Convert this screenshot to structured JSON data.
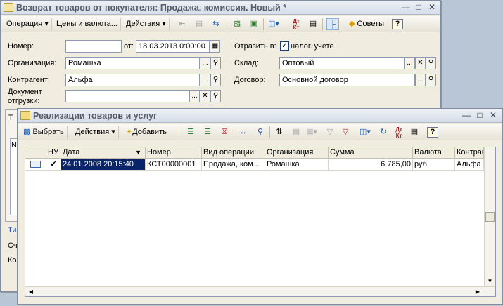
{
  "main_window": {
    "title": "Возврат товаров от покупателя: Продажа, комиссия. Новый *",
    "toolbar": {
      "operation": "Операция",
      "prices": "Цены и валюта...",
      "actions": "Действия",
      "tips": "Советы"
    },
    "form": {
      "number_label": "Номер:",
      "number_value": "",
      "date_label": "от:",
      "date_value": "18.03.2013  0:00:00",
      "reflect_label": "Отразить в:",
      "tax_label": "налог. учете",
      "org_label": "Организация:",
      "org_value": "Ромашка",
      "warehouse_label": "Склад:",
      "warehouse_value": "Оптовый",
      "contractor_label": "Контрагент:",
      "contractor_value": "Альфа",
      "contract_label": "Договор:",
      "contract_value": "Основной договор",
      "doc_label_1": "Документ",
      "doc_label_2": "отгрузки:",
      "doc_value": ""
    },
    "partial": {
      "t": "Т",
      "n": "N",
      "ti": "Ти",
      "sch": "Сч",
      "ko": "Ко"
    }
  },
  "list_window": {
    "title": "Реализации товаров и услуг",
    "toolbar": {
      "select": "Выбрать",
      "actions": "Действия",
      "add": "Добавить"
    },
    "columns": [
      "НУ",
      "Дата",
      "Номер",
      "Вид операции",
      "Организация",
      "Сумма",
      "Валюта",
      "Контраг"
    ],
    "rows": [
      {
        "nu": "✔",
        "date": "24.01.2008 20:15:40",
        "number": "КСТ00000001",
        "operation": "Продажа, ком...",
        "org": "Ромашка",
        "sum": "6 785,00",
        "currency": "руб.",
        "contractor": "Альфа"
      }
    ]
  }
}
